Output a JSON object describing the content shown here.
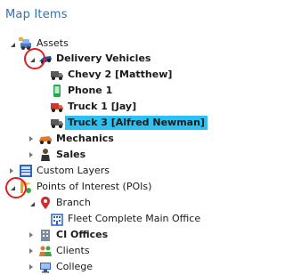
{
  "panel": {
    "title": "Map Items"
  },
  "tree": {
    "assets": {
      "label": "Assets",
      "icon": "assets-icon"
    },
    "delivery_vehicles": {
      "label": "Delivery Vehicles",
      "icon": "truck-blue-icon"
    },
    "chevy": {
      "label": "Chevy 2 [Matthew]",
      "icon": "truck-icon"
    },
    "phone": {
      "label": "Phone 1",
      "icon": "phone-icon"
    },
    "truck1": {
      "label": "Truck 1 [Jay]",
      "icon": "truck-red-icon"
    },
    "truck3": {
      "label": "Truck 3 [Alfred Newman]",
      "icon": "truck-icon",
      "selected": true
    },
    "mechanics": {
      "label": "Mechanics",
      "icon": "car-icon"
    },
    "sales": {
      "label": "Sales",
      "icon": "person-icon"
    },
    "custom_layers": {
      "label": "Custom Layers",
      "icon": "layers-icon"
    },
    "poi": {
      "label": "Points of Interest (POIs)",
      "icon": "poi-icon"
    },
    "branch": {
      "label": "Branch",
      "icon": "pin-icon"
    },
    "fleet_office": {
      "label": "Fleet Complete Main Office",
      "icon": "building-icon"
    },
    "ci_offices": {
      "label": "CI Offices",
      "icon": "office-icon"
    },
    "clients": {
      "label": "Clients",
      "icon": "clients-icon"
    },
    "college": {
      "label": "College",
      "icon": "college-icon"
    }
  },
  "colors": {
    "title": "#2f72b7",
    "selection": "#2cc1f0",
    "annotation": "#e02020"
  }
}
